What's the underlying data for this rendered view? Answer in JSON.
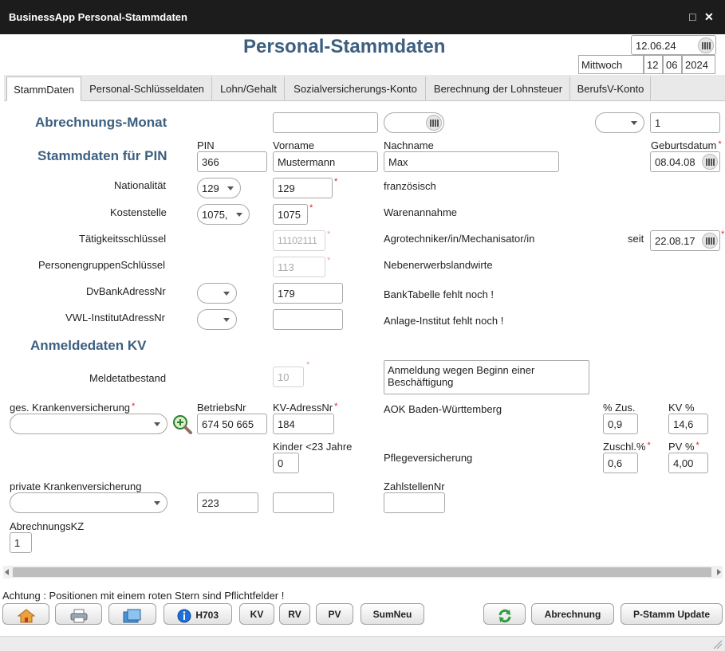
{
  "window": {
    "title": "BusinessApp Personal-Stammdaten",
    "page_title": "Personal-Stammdaten"
  },
  "date": {
    "value": "12.06.24",
    "weekday": "Mittwoch",
    "day": "12",
    "month": "06",
    "year": "2024"
  },
  "tabs": [
    "StammDaten",
    "Personal-Schlüsseldaten",
    "Lohn/Gehalt",
    "Sozialversicherungs-Konto",
    "Berechnung der Lohnsteuer",
    "BerufsV-Konto"
  ],
  "form": {
    "abrechnungs_monat_label": "Abrechnungs-Monat",
    "abrechnungs_monat_counter": "1",
    "stammdaten_label": "Stammdaten für PIN",
    "pin_label": "PIN",
    "pin": "366",
    "vorname_label": "Vorname",
    "vorname": "Mustermann",
    "nachname_label": "Nachname",
    "nachname": "Max",
    "geburtsdatum_label": "Geburtsdatum",
    "geburtsdatum": "08.04.08",
    "nationalitaet_label": "Nationalität",
    "nationalitaet_select": "129",
    "nationalitaet_code": "129",
    "nationalitaet_text": "französisch",
    "kostenstelle_label": "Kostenstelle",
    "kostenstelle_select": "1075,",
    "kostenstelle_code": "1075",
    "kostenstelle_text": "Warenannahme",
    "taetigkeit_label": "Tätigkeitsschlüssel",
    "taetigkeit_code": "11102111",
    "taetigkeit_text": "Agrotechniker/in/Mechanisator/in",
    "seit_label": "seit",
    "seit": "22.08.17",
    "personengruppe_label": "PersonengruppenSchlüssel",
    "personengruppe_code": "113",
    "personengruppe_text": "Nebenerwerbslandwirte",
    "dvbank_label": "DvBankAdressNr",
    "dvbank_code": "179",
    "dvbank_text": "BankTabelle fehlt noch !",
    "vwl_label": "VWL-InstitutAdressNr",
    "vwl_text": "Anlage-Institut fehlt noch !",
    "anmelde_label": "Anmeldedaten KV",
    "meldetat_label": "Meldetatbestand",
    "meldetat_code": "10",
    "meldetat_text": "Anmeldung wegen Beginn einer Beschäftigung",
    "ges_kv_label": "ges. Krankenversicherung",
    "betriebsnr_label": "BetriebsNr",
    "betriebsnr": "674 50 665",
    "kv_adress_label": "KV-AdressNr",
    "kv_adress": "184",
    "kv_name": "AOK Baden-Württemberg",
    "zus_label": "% Zus.",
    "zus": "0,9",
    "kv_pct_label": "KV %",
    "kv_pct": "14,6",
    "kinder_label": "Kinder <23 Jahre",
    "kinder": "0",
    "pflege_label": "Pflegeversicherung",
    "zuschl_label": "Zuschl.%",
    "zuschl": "0,6",
    "pv_label": "PV %",
    "pv": "4,00",
    "private_kv_label": "private Krankenversicherung",
    "private_kv_nr": "223",
    "zahlstellen_label": "ZahlstellenNr",
    "abrechnungskz_label": "AbrechnungsKZ",
    "abrechnungskz": "1"
  },
  "footer": {
    "hint": "Achtung : Positionen mit einem roten Stern sind Pflichtfelder !",
    "btn_h703": "H703",
    "btn_kv": "KV",
    "btn_rv": "RV",
    "btn_pv": "PV",
    "btn_sumneu": "SumNeu",
    "btn_abrechnung": "Abrechnung",
    "btn_pstamm": "P-Stamm Update"
  },
  "icons": [
    "home-icon",
    "printer-icon",
    "folder-icon",
    "info-icon",
    "refresh-icon",
    "zoom-search-icon",
    "calendar-icon",
    "maximize-icon",
    "close-icon"
  ],
  "colors": {
    "titlebar": "#1c1c1c",
    "section_blue": "#3d5f80",
    "required_star": "#e02020"
  }
}
